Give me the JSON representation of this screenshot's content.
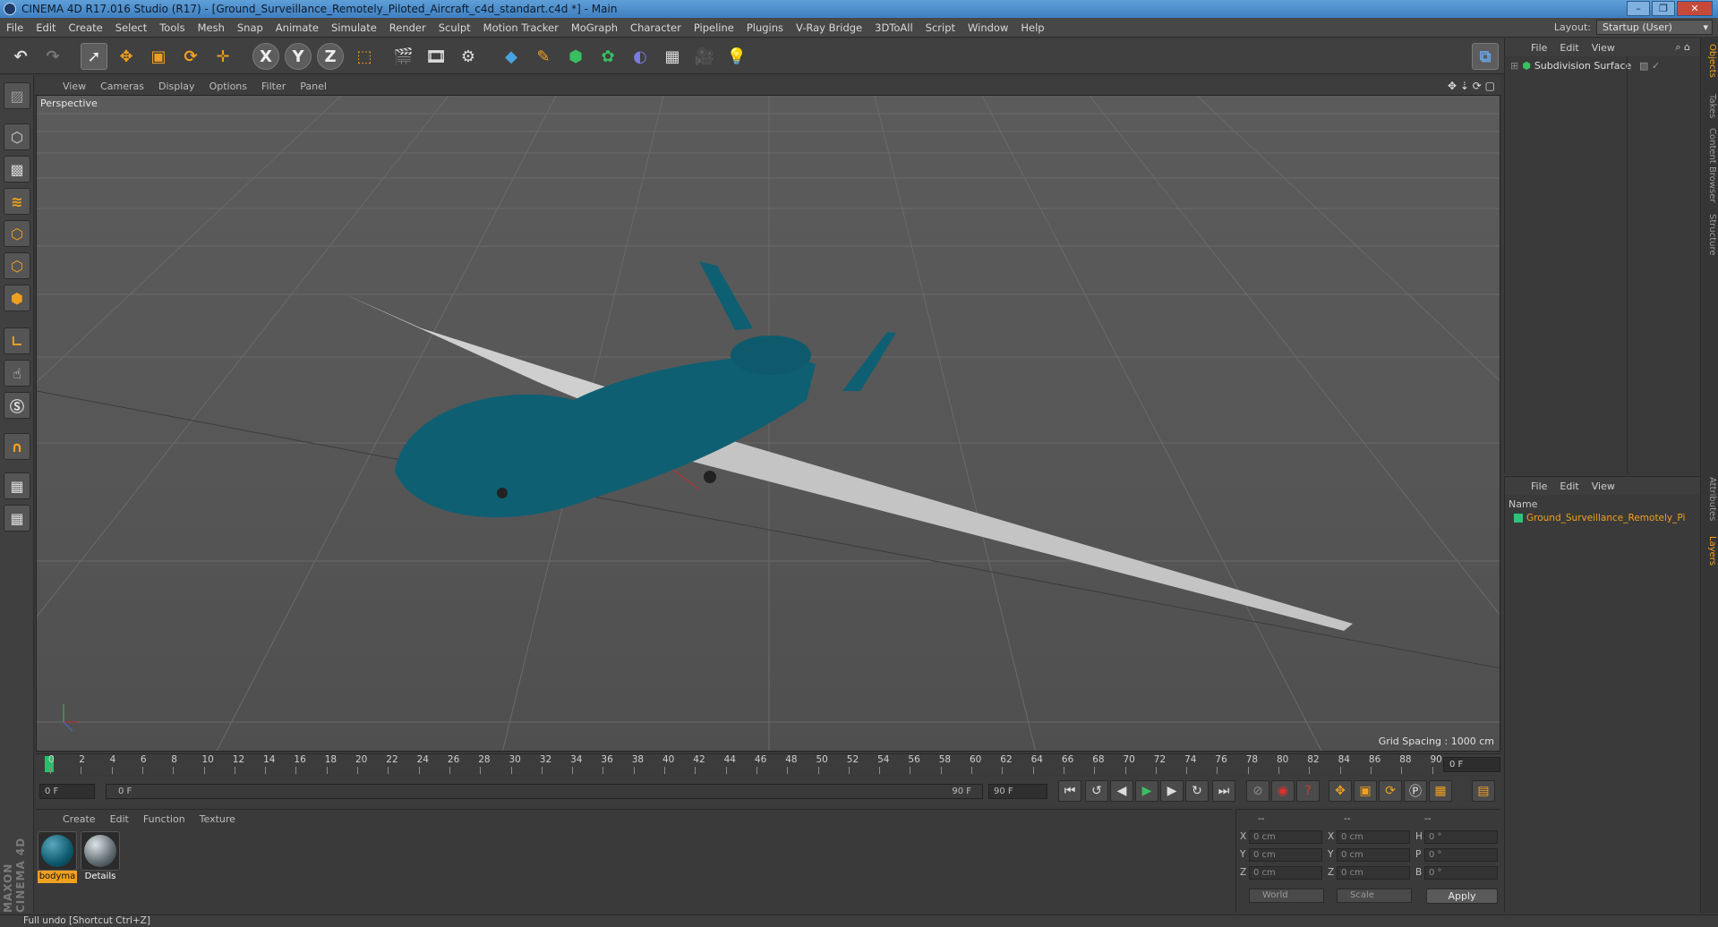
{
  "window": {
    "title": "CINEMA 4D R17.016 Studio (R17) - [Ground_Surveillance_Remotely_Piloted_Aircraft_c4d_standart.c4d *] - Main",
    "controls": [
      "–",
      "❐",
      "✕"
    ]
  },
  "menu": {
    "items": [
      "File",
      "Edit",
      "Create",
      "Select",
      "Tools",
      "Mesh",
      "Snap",
      "Animate",
      "Simulate",
      "Render",
      "Sculpt",
      "Motion Tracker",
      "MoGraph",
      "Character",
      "Pipeline",
      "Plugins",
      "V-Ray Bridge",
      "3DToAll",
      "Script",
      "Window",
      "Help"
    ],
    "layout_label": "Layout:",
    "layout_value": "Startup (User)"
  },
  "toolbar": {
    "axis_x": "X",
    "axis_y": "Y",
    "axis_z": "Z"
  },
  "viewport": {
    "menu": [
      "View",
      "Cameras",
      "Display",
      "Options",
      "Filter",
      "Panel"
    ],
    "label": "Perspective",
    "grid_spacing": "Grid Spacing : 1000 cm",
    "model_color": "#0f5f72",
    "wing_color": "#c9c9c9"
  },
  "timeline": {
    "ticks": [
      "0",
      "2",
      "4",
      "6",
      "8",
      "10",
      "12",
      "14",
      "16",
      "18",
      "20",
      "22",
      "24",
      "26",
      "28",
      "30",
      "32",
      "34",
      "36",
      "38",
      "40",
      "42",
      "44",
      "46",
      "48",
      "50",
      "52",
      "54",
      "56",
      "58",
      "60",
      "62",
      "64",
      "66",
      "68",
      "70",
      "72",
      "74",
      "76",
      "78",
      "80",
      "82",
      "84",
      "86",
      "88",
      "90"
    ],
    "current_frame": "0 F"
  },
  "playback": {
    "start": "0 F",
    "range_start": "0 F",
    "range_end": "90 F",
    "end": "90 F"
  },
  "materials": {
    "menu": [
      "Create",
      "Edit",
      "Function",
      "Texture"
    ],
    "items": [
      {
        "name": "bodyma",
        "color": "#0e5a6e"
      },
      {
        "name": "Details",
        "color": "#5f6a70"
      }
    ]
  },
  "coordinates": {
    "headers": [
      "--",
      "--",
      "--"
    ],
    "rows": [
      {
        "pos_label": "X",
        "pos": "0 cm",
        "size_label": "X",
        "size": "0 cm",
        "rot_label": "H",
        "rot": "0 °"
      },
      {
        "pos_label": "Y",
        "pos": "0 cm",
        "size_label": "Y",
        "size": "0 cm",
        "rot_label": "P",
        "rot": "0 °"
      },
      {
        "pos_label": "Z",
        "pos": "0 cm",
        "size_label": "Z",
        "size": "0 cm",
        "rot_label": "B",
        "rot": "0 °"
      }
    ],
    "mode_world": "World",
    "mode_scale": "Scale",
    "apply": "Apply"
  },
  "objects_panel": {
    "menu": [
      "File",
      "Edit",
      "View"
    ],
    "items": [
      {
        "name": "Subdivision Surface"
      }
    ]
  },
  "layers_panel": {
    "menu": [
      "File",
      "Edit",
      "View"
    ],
    "column": "Name",
    "items": [
      {
        "name": "Ground_Surveillance_Remotely_Pi",
        "color": "#2ec27a"
      }
    ]
  },
  "side_tabs": [
    "Objects",
    "Takes",
    "Content Browser",
    "Structure",
    "Attributes",
    "Layers"
  ],
  "status": {
    "text": "Full undo [Shortcut Ctrl+Z]",
    "brand": "MAXON CINEMA 4D"
  }
}
